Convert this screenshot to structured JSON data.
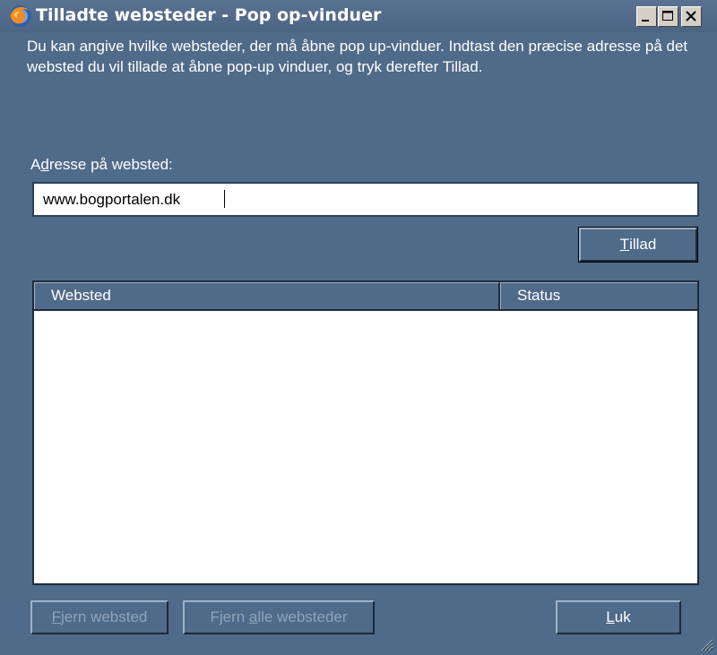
{
  "window": {
    "title": "Tilladte websteder - Pop op-vinduer",
    "controls": {
      "minimize": "minimize",
      "maximize": "maximize",
      "close": "close"
    }
  },
  "description": "Du kan angive hvilke websteder, der må åbne pop up-vinduer. Indtast den præcise adresse på det websted du vil tillade at åbne pop-up vinduer, og tryk derefter Tillad.",
  "address": {
    "label_prefix": "A",
    "label_access_key": "d",
    "label_rest": "resse på websted:",
    "value": "www.bogportalen.dk"
  },
  "buttons": {
    "allow": {
      "access_key": "T",
      "rest": "illad"
    },
    "remove_site": {
      "prefix": "",
      "access_key": "F",
      "rest": "jern websted",
      "enabled": false
    },
    "remove_all": {
      "prefix": "Fjern ",
      "access_key": "a",
      "rest": "lle websteder",
      "enabled": false
    },
    "close": {
      "access_key": "L",
      "rest": "uk"
    }
  },
  "site_list": {
    "columns": [
      "Websted",
      "Status"
    ],
    "rows": []
  },
  "colors": {
    "window_bg": "#506a89",
    "text": "#ffffff",
    "disabled_text": "#8fa3ba"
  },
  "icons": {
    "app": "firefox-icon",
    "grip": "resize-grip-icon"
  }
}
